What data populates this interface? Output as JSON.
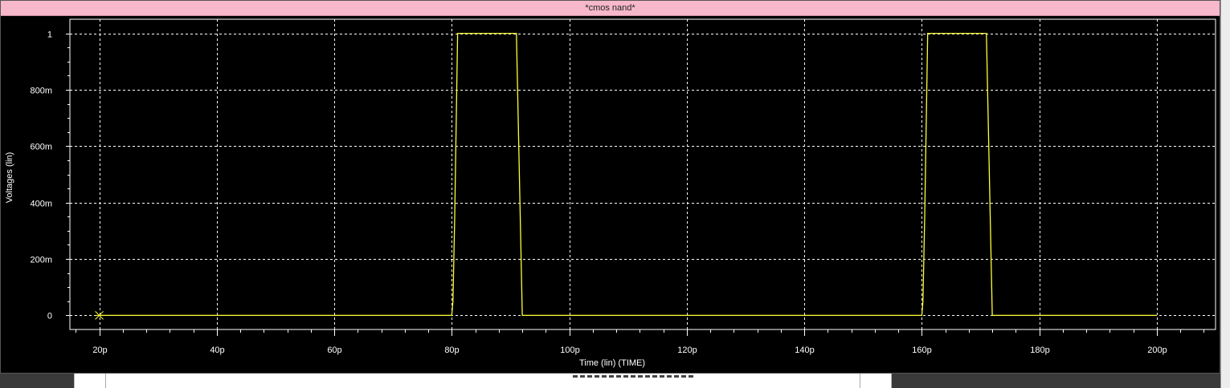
{
  "window": {
    "title": "*cmos nand*"
  },
  "colors": {
    "background": "#000000",
    "grid": "#ffffff",
    "trace": "#ffff33",
    "title_bar": "#f7b8cc"
  },
  "chart_data": {
    "type": "line",
    "title": "*cmos nand*",
    "xlabel": "Time (lin) (TIME)",
    "ylabel": "Voltages (lin)",
    "xlim": [
      15,
      210
    ],
    "ylim": [
      -0.05,
      1.05
    ],
    "x_ticks": [
      20,
      40,
      60,
      80,
      100,
      120,
      140,
      160,
      180,
      200
    ],
    "x_tick_labels": [
      "20p",
      "40p",
      "60p",
      "80p",
      "100p",
      "120p",
      "140p",
      "160p",
      "180p",
      "200p"
    ],
    "y_ticks": [
      0,
      0.2,
      0.4,
      0.6,
      0.8,
      1
    ],
    "y_tick_labels": [
      "0",
      "200m",
      "400m",
      "600m",
      "800m",
      "1"
    ],
    "grid": true,
    "series": [
      {
        "x": [
          20,
          80,
          80.2,
          80.5,
          81,
          91,
          92,
          160,
          160.2,
          160.5,
          161,
          171,
          172,
          200
        ],
        "y": [
          0,
          0,
          0.05,
          0.35,
          1,
          1,
          0,
          0,
          0.05,
          0.35,
          1,
          1,
          0,
          0
        ]
      }
    ],
    "marker": {
      "x": 20,
      "y": 0,
      "symbol": "x-star"
    }
  }
}
